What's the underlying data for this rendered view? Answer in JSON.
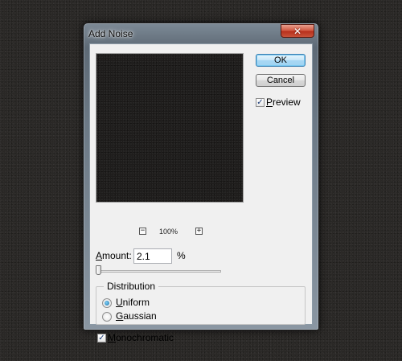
{
  "window": {
    "title": "Add Noise",
    "close_glyph": "✕"
  },
  "preview": {
    "zoom_out_glyph": "−",
    "zoom_in_glyph": "+",
    "zoom_level": "100%"
  },
  "buttons": {
    "ok_label": "OK",
    "cancel_label": "Cancel"
  },
  "preview_toggle": {
    "label": "Preview",
    "checked": true,
    "check_glyph": "✓"
  },
  "amount": {
    "label": "Amount:",
    "value": "2.1",
    "unit": "%",
    "slider_fraction": 0.0
  },
  "distribution": {
    "title": "Distribution",
    "options": [
      {
        "label": "Uniform",
        "selected": true
      },
      {
        "label": "Gaussian",
        "selected": false
      }
    ]
  },
  "monochromatic": {
    "label": "Monochromatic",
    "checked": true,
    "check_glyph": "✓"
  },
  "colors": {
    "desktop_bg": "#2a2826",
    "dialog_bg": "#f0f0f0",
    "ok_accent": "#3c7fb1",
    "close_red": "#c8533a"
  }
}
